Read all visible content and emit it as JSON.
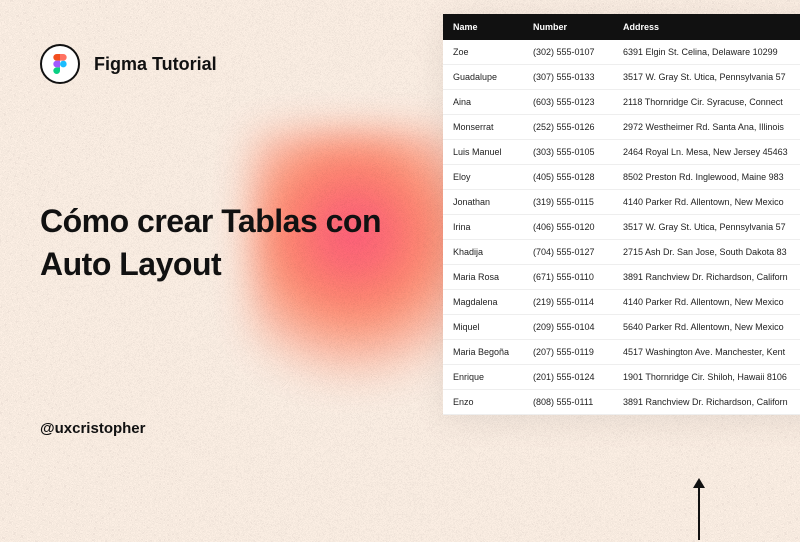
{
  "brand": {
    "label": "Figma Tutorial"
  },
  "title": "Cómo crear Tablas con Auto Layout",
  "author": "@uxcristopher",
  "table": {
    "headers": {
      "name": "Name",
      "number": "Number",
      "address": "Address"
    },
    "rows": [
      {
        "name": "Zoe",
        "number": "(302) 555-0107",
        "address": "6391 Elgin St. Celina, Delaware 10299"
      },
      {
        "name": "Guadalupe",
        "number": "(307) 555-0133",
        "address": "3517 W. Gray St. Utica, Pennsylvania 57"
      },
      {
        "name": "Aina",
        "number": "(603) 555-0123",
        "address": "2118 Thornridge Cir. Syracuse, Connect"
      },
      {
        "name": "Monserrat",
        "number": "(252) 555-0126",
        "address": "2972 Westheimer Rd. Santa Ana, Illinois"
      },
      {
        "name": "Luis Manuel",
        "number": "(303) 555-0105",
        "address": "2464 Royal Ln. Mesa, New Jersey 45463"
      },
      {
        "name": "Eloy",
        "number": "(405) 555-0128",
        "address": "8502 Preston Rd. Inglewood, Maine 983"
      },
      {
        "name": "Jonathan",
        "number": "(319) 555-0115",
        "address": "4140 Parker Rd. Allentown, New Mexico"
      },
      {
        "name": "Irina",
        "number": "(406) 555-0120",
        "address": "3517 W. Gray St. Utica, Pennsylvania 57"
      },
      {
        "name": "Khadija",
        "number": "(704) 555-0127",
        "address": "2715 Ash Dr. San Jose, South Dakota 83"
      },
      {
        "name": "Maria Rosa",
        "number": "(671) 555-0110",
        "address": "3891 Ranchview Dr. Richardson, Californ"
      },
      {
        "name": "Magdalena",
        "number": "(219) 555-0114",
        "address": "4140 Parker Rd. Allentown, New Mexico"
      },
      {
        "name": "Miquel",
        "number": "(209) 555-0104",
        "address": "5640 Parker Rd. Allentown, New Mexico"
      },
      {
        "name": "Maria Begoña",
        "number": "(207) 555-0119",
        "address": "4517 Washington Ave. Manchester, Kent"
      },
      {
        "name": "Enrique",
        "number": "(201) 555-0124",
        "address": "1901 Thornridge Cir. Shiloh, Hawaii 8106"
      },
      {
        "name": "Enzo",
        "number": "(808) 555-0111",
        "address": "3891 Ranchview Dr. Richardson, Californ"
      }
    ]
  }
}
